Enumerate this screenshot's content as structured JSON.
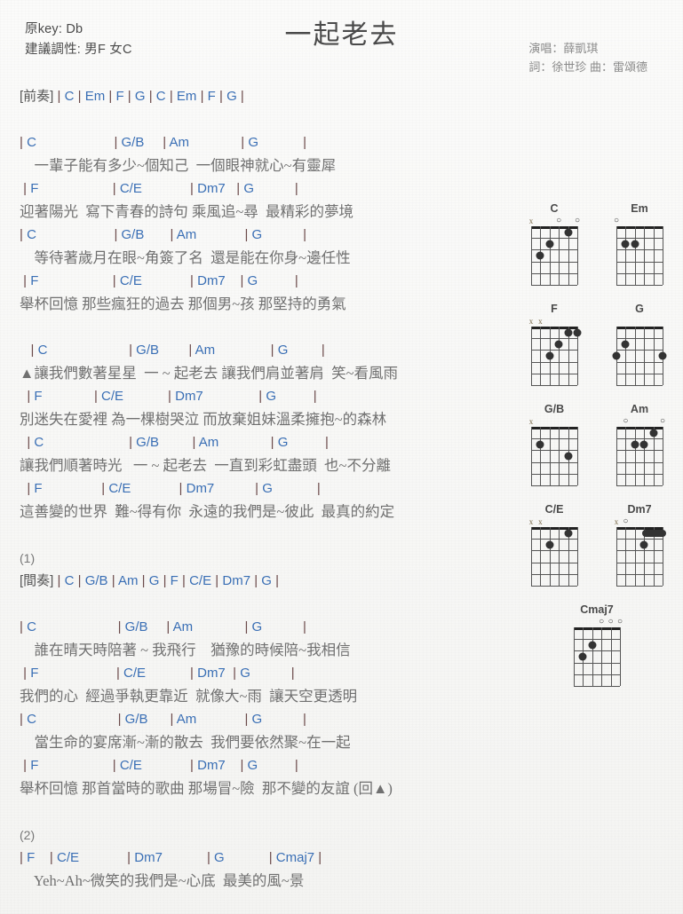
{
  "header": {
    "original_key": "原key: Db",
    "suggested_key": "建議調性: 男F 女C",
    "title": "一起老去",
    "singer": "演唱：薛凱琪",
    "writers": "詞：徐世珍  曲：雷頌德"
  },
  "content": [
    {
      "type": "section",
      "text": "[前奏] | C | Em | F | G | C | Em | F | G |"
    },
    {
      "type": "spacer"
    },
    {
      "type": "chords",
      "text": "| C                     | G/B     | Am              | G            |"
    },
    {
      "type": "lyric",
      "text": "    一輩子能有多少~個知己  一個眼神就心~有靈犀"
    },
    {
      "type": "chords",
      "text": " | F                    | C/E             | Dm7   | G           |"
    },
    {
      "type": "lyric",
      "text": "迎著陽光  寫下青春的詩句 乘風追~尋  最精彩的夢境"
    },
    {
      "type": "chords",
      "text": "| C                     | G/B       | Am             | G           |"
    },
    {
      "type": "lyric",
      "text": "    等待著歲月在眼~角簽了名  還是能在你身~邊任性"
    },
    {
      "type": "chords",
      "text": " | F                    | C/E             | Dm7    | G          |"
    },
    {
      "type": "lyric",
      "text": "舉杯回憶 那些瘋狂的過去 那個男~孩 那堅持的勇氣"
    },
    {
      "type": "spacer"
    },
    {
      "type": "chords",
      "text": "   | C                      | G/B        | Am               | G         |"
    },
    {
      "type": "lyric",
      "text": "▲讓我們數著星星  一 ~ 起老去 讓我們肩並著肩  笑~看風雨"
    },
    {
      "type": "chords",
      "text": "  | F              | C/E            | Dm7               | G          |"
    },
    {
      "type": "lyric",
      "text": "別迷失在愛裡 為一棵樹哭泣 而放棄姐妹溫柔擁抱~的森林"
    },
    {
      "type": "chords",
      "text": "  | C                       | G/B         | Am              | G          |"
    },
    {
      "type": "lyric",
      "text": "讓我們順著時光   一 ~ 起老去  一直到彩虹盡頭  也~不分離"
    },
    {
      "type": "chords",
      "text": "  | F                | C/E             | Dm7           | G            |"
    },
    {
      "type": "lyric",
      "text": "這善變的世界  難~得有你  永遠的我們是~彼此  最真的約定"
    },
    {
      "type": "spacer"
    },
    {
      "type": "label",
      "text": "(1)"
    },
    {
      "type": "section",
      "text": "[間奏] | C | G/B | Am | G | F | C/E | Dm7 | G |"
    },
    {
      "type": "spacer"
    },
    {
      "type": "chords",
      "text": "| C                      | G/B     | Am              | G           |"
    },
    {
      "type": "lyric",
      "text": "    誰在晴天時陪著 ~ 我飛行    猶豫的時候陪~我相信"
    },
    {
      "type": "chords",
      "text": " | F                     | C/E            | Dm7  | G           |"
    },
    {
      "type": "lyric",
      "text": "我們的心  經過爭執更靠近  就像大~雨  讓天空更透明"
    },
    {
      "type": "chords",
      "text": "| C                      | G/B      | Am             | G           |"
    },
    {
      "type": "lyric",
      "text": "    當生命的宴席漸~漸的散去  我們要依然聚~在一起"
    },
    {
      "type": "chords",
      "text": " | F                    | C/E             | Dm7    | G          |"
    },
    {
      "type": "lyric",
      "text": "舉杯回憶 那首當時的歌曲 那場冒~險  那不變的友誼 (回▲)"
    },
    {
      "type": "spacer"
    },
    {
      "type": "label",
      "text": "(2)"
    },
    {
      "type": "chords",
      "text": "| F    | C/E             | Dm7            | G            | Cmaj7 |"
    },
    {
      "type": "lyric",
      "text": "    Yeh~Ah~微笑的我們是~心底  最美的風~景"
    }
  ],
  "diagrams": [
    {
      "name": "C",
      "markers": [
        {
          "string": 6,
          "symbol": "x"
        },
        {
          "string": 3,
          "symbol": "o"
        },
        {
          "string": 1,
          "symbol": "o"
        }
      ],
      "dots": [
        {
          "string": 5,
          "fret": 3
        },
        {
          "string": 4,
          "fret": 2
        },
        {
          "string": 2,
          "fret": 1
        }
      ],
      "barres": []
    },
    {
      "name": "Em",
      "markers": [
        {
          "string": 6,
          "symbol": "o"
        }
      ],
      "dots": [
        {
          "string": 5,
          "fret": 2
        },
        {
          "string": 4,
          "fret": 2
        }
      ],
      "barres": []
    },
    {
      "name": "F",
      "markers": [
        {
          "string": 6,
          "symbol": "x"
        },
        {
          "string": 5,
          "symbol": "x"
        }
      ],
      "dots": [
        {
          "string": 4,
          "fret": 3
        },
        {
          "string": 3,
          "fret": 2
        },
        {
          "string": 2,
          "fret": 1
        },
        {
          "string": 1,
          "fret": 1
        }
      ],
      "barres": []
    },
    {
      "name": "G",
      "markers": [],
      "dots": [
        {
          "string": 6,
          "fret": 3
        },
        {
          "string": 5,
          "fret": 2
        },
        {
          "string": 1,
          "fret": 3
        }
      ],
      "barres": []
    },
    {
      "name": "G/B",
      "markers": [
        {
          "string": 6,
          "symbol": "x"
        }
      ],
      "dots": [
        {
          "string": 5,
          "fret": 2
        },
        {
          "string": 2,
          "fret": 3
        }
      ],
      "barres": []
    },
    {
      "name": "Am",
      "markers": [
        {
          "string": 5,
          "symbol": "o"
        },
        {
          "string": 1,
          "symbol": "o"
        }
      ],
      "dots": [
        {
          "string": 2,
          "fret": 1
        },
        {
          "string": 4,
          "fret": 2
        },
        {
          "string": 3,
          "fret": 2
        }
      ],
      "barres": []
    },
    {
      "name": "C/E",
      "markers": [
        {
          "string": 6,
          "symbol": "x"
        },
        {
          "string": 5,
          "symbol": "x"
        }
      ],
      "dots": [
        {
          "string": 2,
          "fret": 1
        },
        {
          "string": 4,
          "fret": 2
        }
      ],
      "barres": []
    },
    {
      "name": "Dm7",
      "markers": [
        {
          "string": 6,
          "symbol": "x"
        },
        {
          "string": 5,
          "symbol": "o"
        }
      ],
      "dots": [
        {
          "string": 3,
          "fret": 2
        }
      ],
      "barres": [
        {
          "fret": 1,
          "from_string": 3,
          "to_string": 1
        }
      ]
    },
    {
      "name": "Cmaj7",
      "markers": [
        {
          "string": 3,
          "symbol": "o"
        },
        {
          "string": 2,
          "symbol": "o"
        },
        {
          "string": 1,
          "symbol": "o"
        }
      ],
      "dots": [
        {
          "string": 5,
          "fret": 3
        },
        {
          "string": 4,
          "fret": 2
        }
      ],
      "barres": []
    }
  ],
  "diagram_rows": [
    [
      "C",
      "Em"
    ],
    [
      "F",
      "G"
    ],
    [
      "G/B",
      "Am"
    ],
    [
      "C/E",
      "Dm7"
    ],
    [
      "Cmaj7"
    ]
  ],
  "colors": {
    "chord_blue": "#3a6fb5",
    "bar_brown": "#6b4a4a",
    "lyric_gray": "#707070",
    "page_bg": "#f7f7f5"
  }
}
